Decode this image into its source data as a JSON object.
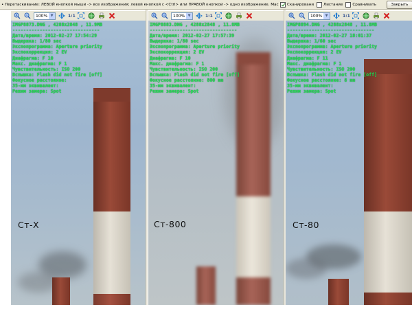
{
  "topbar": {
    "hint": "• Перетаскивание: ЛЕВОЙ кнопкой мыши -> все изображения; левой кнопкой с <Ctrl> или ПРАВОЙ кнопкой -> одно изображение. Мас",
    "options": [
      {
        "label": "Сканировани",
        "checked": true
      },
      {
        "label": "Листание",
        "checked": false
      },
      {
        "label": "Сравнивать",
        "checked": false
      }
    ],
    "close_label": "Закрыть"
  },
  "toolbar": {
    "zoom_value": "100%",
    "one_to_one": "1:1",
    "icons": [
      "zoom-in-icon",
      "zoom-out-icon",
      "move-icon",
      "one-to-one",
      "fit-icon",
      "globe-icon",
      "print-icon",
      "close-icon"
    ]
  },
  "panels": [
    {
      "file": "IMGP8873.DNG , 4288x2848 , 11.9MB",
      "separator": "--------------------------------",
      "lines": [
        "Дата/время: 2012-02-27 17:54:29",
        "Выдержка: 1/80 sec",
        "Экспопрограмма: Aperture priority",
        "Экспокоррекция: 2 EV",
        "Диафрагма: F 10",
        "Макс. диафрагма: F 1",
        "Чувствительность: ISO 200",
        "Вспышка: Flash did not fire [off]",
        "Фокусное расстояние:",
        "35-мм эквивалент:",
        "Режим замера: Spot"
      ],
      "caption": "Ст-Х"
    },
    {
      "file": "IMGP8883.DNG , 4288x2848 , 11.8MB",
      "separator": "--------------------------------",
      "lines": [
        "Дата/время: 2012-02-27 17:57:39",
        "Выдержка: 1/80 sec",
        "Экспопрограмма: Aperture priority",
        "Экспокоррекция: 2 EV",
        "Диафрагма: F 10",
        "Макс. диафрагма: F 1",
        "Чувствительность: ISO 200",
        "Вспышка: Flash did not fire [off]",
        "Фокусное расстояние: 800 mm",
        "35-мм эквивалент:",
        "Режим замера: Spot"
      ],
      "caption": "Ст-800"
    },
    {
      "file": "IMGP8894.DNG , 4288x2848 , 11.8MB",
      "separator": "--------------------------------",
      "lines": [
        "Дата/время: 2012-02-27 18:01:37",
        "Выдержка: 1/60 sec",
        "Экспопрограмма: Aperture priority",
        "Экспокоррекция: 2 EV",
        "Диафрагма: F 11",
        "Макс. диафрагма: F 1",
        "Чувствительность: ISO 200",
        "Вспышка: Flash did not fire [off]",
        "Фокусное расстояние: 8 mm",
        "35-мм эквивалент:",
        "Режим замера: Spot"
      ],
      "caption": "Ст-80"
    }
  ],
  "colors": {
    "overlay_text": "#27e05a",
    "chimney_red": "#8c4233",
    "chimney_white": "#ddd8cc",
    "close_icon": "#d42020"
  }
}
